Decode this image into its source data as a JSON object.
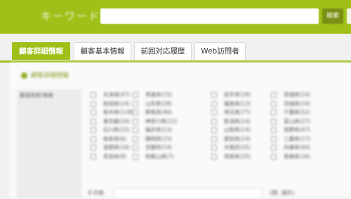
{
  "header": {
    "keyword_label": "キーワード",
    "search_value": "",
    "search_placeholder": "",
    "search_button_label": "検索"
  },
  "tabs": [
    {
      "label": "顧客詳細情報",
      "active": true
    },
    {
      "label": "顧客基本情報",
      "active": false
    },
    {
      "label": "前回対応履歴",
      "active": false
    },
    {
      "label": "Web訪問者",
      "active": false
    }
  ],
  "section": {
    "title": "顧客詳細情報",
    "side_label": "都道府県/地域"
  },
  "prefectures": [
    [
      "北海道(47)",
      "青森県(15)",
      "岩手県(18)",
      "宮城県(14)"
    ],
    [
      "秋田県(14)",
      "山形県(28)",
      "福島県(13)",
      "茨城県(14)"
    ],
    [
      "栃木県(118)",
      "群馬県(40)",
      "埼玉県(77)",
      "千葉県(52)"
    ],
    [
      "東京都(16)",
      "神奈川県(12)",
      "新潟県(14)",
      "富山県(27)"
    ],
    [
      "石川県(15)",
      "福井県(13)",
      "山梨県(14)",
      "長野県(47)"
    ],
    [
      "岐阜県(6)",
      "静岡県(15)",
      "愛知県(14)",
      "三重県(17)"
    ],
    [
      "滋賀県(16)",
      "京都府(14)",
      "大阪府(25)",
      "兵庫県(40)"
    ],
    [
      "奈良県(8)",
      "和歌山県(7)",
      "鳥取県(25)",
      "島根県(16)"
    ]
  ],
  "bottom": {
    "label": "その他",
    "right_label": "(例: 海外)"
  },
  "colors": {
    "brand": "#9fc019",
    "brand_dark": "#7a8f16",
    "background": "#f1f1f1"
  }
}
